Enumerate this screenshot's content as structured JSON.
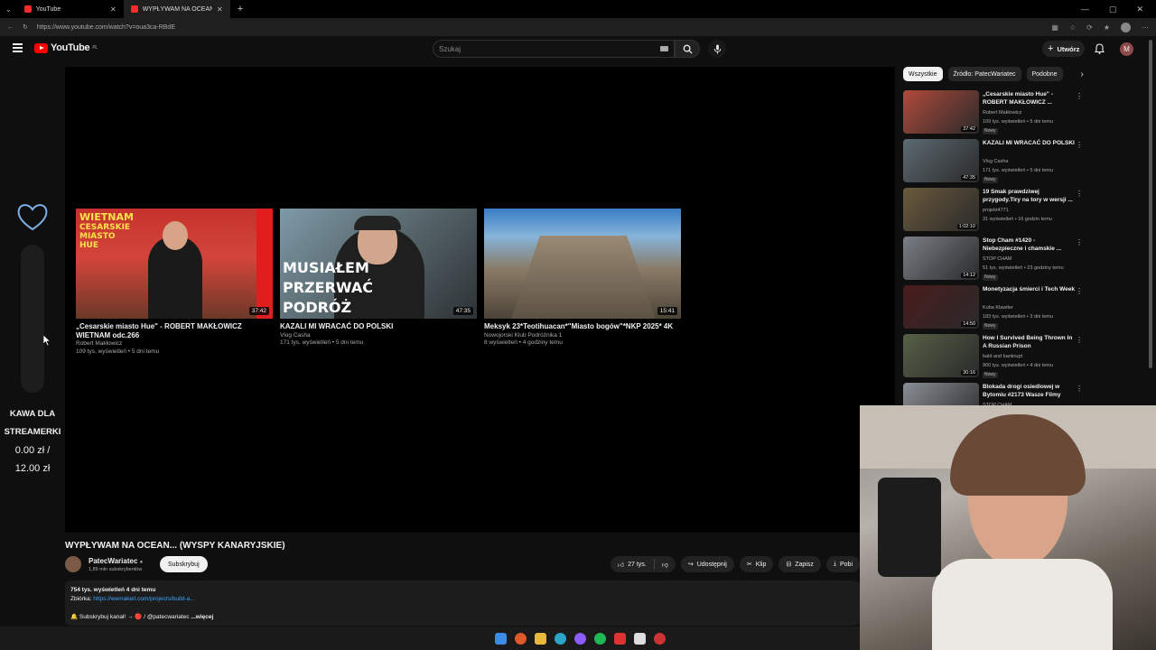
{
  "browser": {
    "tabs": [
      {
        "label": "YouTube"
      },
      {
        "label": "WYPŁYWAM NA OCEAN... (WYSP..."
      }
    ],
    "url": "https://www.youtube.com/watch?v=oua3ca-RBdE"
  },
  "header": {
    "logo": "YouTube",
    "region": "PL",
    "search_placeholder": "Szukaj",
    "create_label": "Utwórz",
    "avatar_letter": "M"
  },
  "endscreen": [
    {
      "title": "„Cesarskie miasto Hue\" - ROBERT MAKŁOWICZ WIETNAM odc.266",
      "channel": "Robert Makłowicz",
      "stats": "109 tys. wyświetleń • 5 dni temu",
      "duration": "37:42",
      "overlay": [
        "WIETNAM",
        "CESARSKIE",
        "MIASTO",
        "HUE"
      ]
    },
    {
      "title": "KAZALI MI WRACAĆ DO POLSKI",
      "channel": "Vlog Casha",
      "stats": "171 tys. wyświetleń • 5 dni temu",
      "duration": "47:35",
      "overlay": [
        "MUSIAŁEM",
        "PRZERWAĆ",
        "PODRÓŻ"
      ]
    },
    {
      "title": "Meksyk 23*Teotihuacan*\"Miasto bogów\"*NKP 2025* 4K",
      "channel": "Nowojorski Klub Podróżnika 1",
      "stats": "8 wyświetleń • 4 godziny temu",
      "duration": "15:41",
      "overlay": []
    }
  ],
  "widget": {
    "label_line1": "KAWA DLA",
    "label_line2": "STREAMERKI",
    "current": "0.00 zł /",
    "goal": "12.00 zł"
  },
  "video": {
    "title": "WYPŁYWAM NA OCEAN... (WYSPY KANARYJSKIE)",
    "channel": "PatecWariatec",
    "subscribers": "1,89 mln subskrybentów",
    "subscribe_label": "Subskrybuj",
    "likes": "27 tys.",
    "share_label": "Udostępnij",
    "clip_label": "Klip",
    "save_label": "Zapisz",
    "download_label": "Pobi",
    "desc_stats": "754 tys. wyświetleń  4 dni temu",
    "desc_line2_prefix": "Zbiórka: ",
    "desc_link": "https://wemakeit.com/projects/build-a...",
    "desc_line3": "🔔 Subskrybuj kanał! → 🔴 / @patecwariatec",
    "desc_more": "...więcej"
  },
  "sidebar": {
    "chips": [
      "Wszystkie",
      "Źródło: PatecWariatec",
      "Podobne"
    ],
    "items": [
      {
        "title": "„Cesarskie miasto Hue\" - ROBERT MAKŁOWICZ ...",
        "channel": "Robert Makłowicz",
        "stats": "109 tys. wyświetleń • 5 dni temu",
        "badge": "Nowy",
        "duration": "37:42",
        "color": "#b04a3a"
      },
      {
        "title": "KAZALI MI WRACAĆ DO POLSKI",
        "channel": "Vlog Casha",
        "stats": "171 tys. wyświetleń • 5 dni temu",
        "badge": "Nowy",
        "duration": "47:35",
        "color": "#5c6a72"
      },
      {
        "title": "19 Smak prawdziwej przygody.Tiry na tory w wersji ...",
        "channel": "projekt4771",
        "stats": "31 wyświetleń • 16 godzin temu",
        "badge": "",
        "duration": "1:02:10",
        "color": "#6a5a3c"
      },
      {
        "title": "Stop Cham #1420 - Niebezpieczne i chamskie ...",
        "channel": "STOP CHAM",
        "stats": "51 tys. wyświetleń • 23 godziny temu",
        "badge": "Nowy",
        "duration": "14:12",
        "color": "#7a7f86"
      },
      {
        "title": "Monetyzacja śmierci i Tech Week",
        "channel": "Kuba Klawiter",
        "stats": "183 tys. wyświetleń • 3 dni temu",
        "badge": "Nowy",
        "duration": "14:50",
        "color": "#4a1c1c"
      },
      {
        "title": "How I Survived Being Thrown In A Russian Prison",
        "channel": "bald and bankrupt",
        "stats": "900 tys. wyświetleń • 4 dni temu",
        "badge": "Nowy",
        "duration": "30:16",
        "color": "#566046"
      },
      {
        "title": "Blokada drogi osiedlowej w Bytomiu #2173 Wasze Filmy",
        "channel": "STOP CHAM",
        "stats": "",
        "badge": "",
        "duration": "",
        "color": "#8a8f96"
      }
    ]
  },
  "colors": {
    "accent": "#ff0000",
    "link": "#3ea6ff",
    "background": "#0f0f0f"
  }
}
